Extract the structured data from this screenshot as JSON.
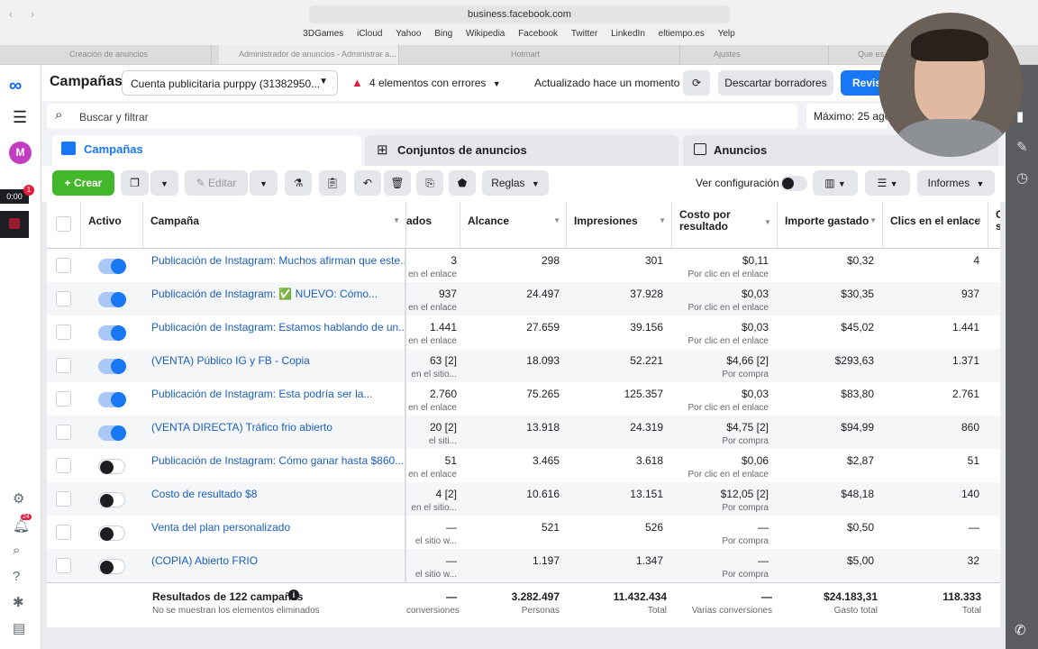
{
  "browser": {
    "url": "business.facebook.com",
    "bookmarks": [
      "3DGames",
      "iCloud",
      "Yahoo",
      "Bing",
      "Wikipedia",
      "Facebook",
      "Twitter",
      "LinkedIn",
      "eltiempo.es",
      "Yelp"
    ],
    "tabs": [
      "Creación de anuncios",
      "Administrador de anuncios - Administrar a...",
      "Hotmart",
      "Ajustes",
      "Que es"
    ]
  },
  "header": {
    "title": "Campañas",
    "account": "Cuenta publicitaria purppy (31382950...",
    "errors": "4 elementos con errores",
    "updated": "Actualizado hace un momento",
    "discard": "Descartar borradores",
    "review": "Revis"
  },
  "search": {
    "placeholder": "Buscar y filtrar",
    "max": "Máximo: 25 ago"
  },
  "level_tabs": [
    "Campañas",
    "Conjuntos de anuncios",
    "Anuncios"
  ],
  "toolbar": {
    "create": "Crear",
    "edit": "Editar",
    "rules": "Reglas",
    "view_config": "Ver configuración",
    "reports": "Informes"
  },
  "rail": {
    "timer": "0:00",
    "notif_count": "24",
    "badge": "1",
    "avatar": "M"
  },
  "columns": {
    "active": "Activo",
    "campaign": "Campaña",
    "results": "ados",
    "reach": "Alcance",
    "impressions": "Impresiones",
    "cost": "Costo por resultado",
    "spent": "Importe gastado",
    "clicks": "Clics en el enlace",
    "extra": "C s"
  },
  "rows": [
    {
      "name": "Publicación de Instagram: Muchos afirman que este...",
      "on": true,
      "res": "3",
      "res_sub": "en el enlace",
      "reach": "298",
      "impr": "301",
      "cost": "$0,11",
      "cost_sub": "Por clic en el enlace",
      "spent": "$0,32",
      "clicks": "4"
    },
    {
      "name": "Publicación de Instagram: ✅ NUEVO: Cómo...",
      "on": true,
      "res": "937",
      "res_sub": "en el enlace",
      "reach": "24.497",
      "impr": "37.928",
      "cost": "$0,03",
      "cost_sub": "Por clic en el enlace",
      "spent": "$30,35",
      "clicks": "937"
    },
    {
      "name": "Publicación de Instagram: Estamos hablando de un...",
      "on": true,
      "res": "1.441",
      "res_sub": "en el enlace",
      "reach": "27.659",
      "impr": "39.156",
      "cost": "$0,03",
      "cost_sub": "Por clic en el enlace",
      "spent": "$45,02",
      "clicks": "1.441"
    },
    {
      "name": "(VENTA) Público IG y FB - Copia",
      "on": true,
      "res": "63 [2]",
      "res_sub": "en el sitio...",
      "reach": "18.093",
      "impr": "52.221",
      "cost": "$4,66 [2]",
      "cost_sub": "Por compra",
      "spent": "$293,63",
      "clicks": "1.371"
    },
    {
      "name": "Publicación de Instagram: Esta podría ser la...",
      "on": true,
      "res": "2.760",
      "res_sub": "en el enlace",
      "reach": "75.265",
      "impr": "125.357",
      "cost": "$0,03",
      "cost_sub": "Por clic en el enlace",
      "spent": "$83,80",
      "clicks": "2.761"
    },
    {
      "name": "(VENTA DIRECTA) Tráfico frio abierto",
      "on": true,
      "res": "20 [2]",
      "res_sub": "el siti...",
      "reach": "13.918",
      "impr": "24.319",
      "cost": "$4,75 [2]",
      "cost_sub": "Por compra",
      "spent": "$94,99",
      "clicks": "860"
    },
    {
      "name": "Publicación de Instagram: Cómo ganar hasta $860...",
      "on": false,
      "res": "51",
      "res_sub": "en el enlace",
      "reach": "3.465",
      "impr": "3.618",
      "cost": "$0,06",
      "cost_sub": "Por clic en el enlace",
      "spent": "$2,87",
      "clicks": "51"
    },
    {
      "name": "Costo de resultado $8",
      "on": false,
      "res": "4 [2]",
      "res_sub": "en el sitio...",
      "reach": "10.616",
      "impr": "13.151",
      "cost": "$12,05 [2]",
      "cost_sub": "Por compra",
      "spent": "$48,18",
      "clicks": "140"
    },
    {
      "name": "Venta del plan personalizado",
      "on": false,
      "res": "—",
      "res_sub": "el sitio w...",
      "reach": "521",
      "impr": "526",
      "cost": "—",
      "cost_sub": "Por compra",
      "spent": "$0,50",
      "clicks": "—"
    },
    {
      "name": "(COPIA) Abierto FRIO",
      "on": false,
      "res": "—",
      "res_sub": "el sitio w...",
      "reach": "1.197",
      "impr": "1.347",
      "cost": "—",
      "cost_sub": "Por compra",
      "spent": "$5,00",
      "clicks": "32"
    }
  ],
  "totals": {
    "label": "Resultados de 122 campañas",
    "note": "No se muestran los elementos eliminados",
    "res": "—",
    "res_sub": "conversiones",
    "reach": "3.282.497",
    "reach_sub": "Personas",
    "impr": "11.432.434",
    "impr_sub": "Total",
    "cost": "—",
    "cost_sub": "Varias conversiones",
    "spent": "$24.183,31",
    "spent_sub": "Gasto total",
    "clicks": "118.333",
    "clicks_sub": "Total"
  }
}
